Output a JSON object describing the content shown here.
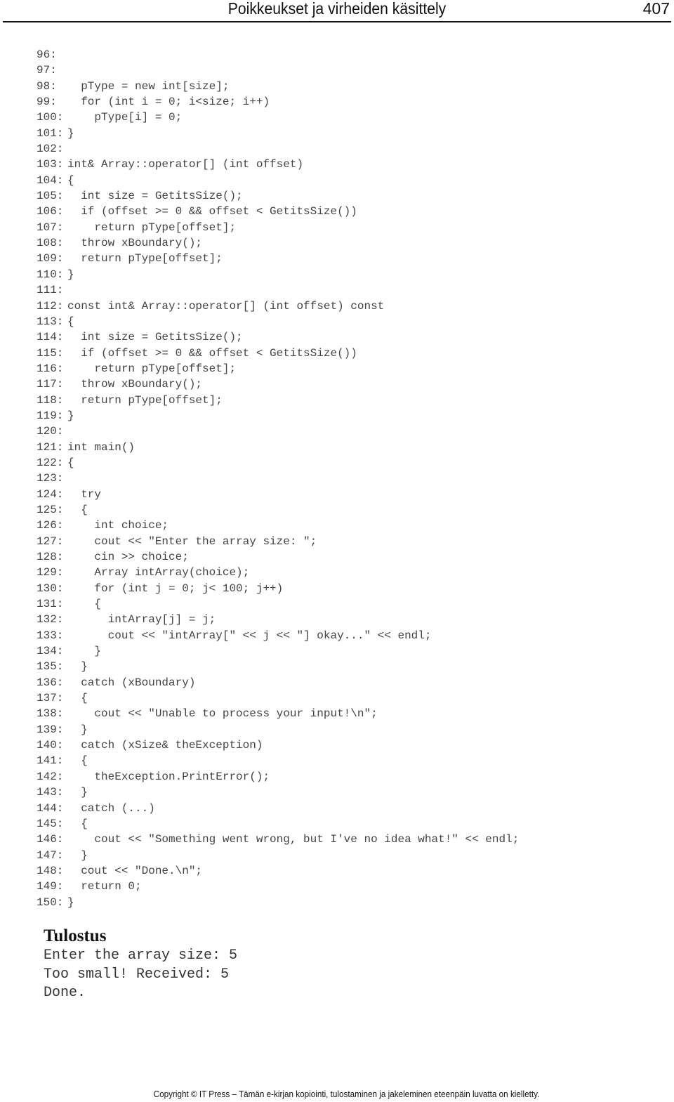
{
  "header": {
    "title": "Poikkeukset ja virheiden käsittely",
    "page_number": "407"
  },
  "code": [
    {
      "num": "96:",
      "text": ""
    },
    {
      "num": "97:",
      "text": ""
    },
    {
      "num": "98:",
      "text": "  pType = new int[size];"
    },
    {
      "num": "99:",
      "text": "  for (int i = 0; i<size; i++)"
    },
    {
      "num": "100:",
      "text": "    pType[i] = 0;"
    },
    {
      "num": "101:",
      "text": "}"
    },
    {
      "num": "102:",
      "text": ""
    },
    {
      "num": "103:",
      "text": "int& Array::operator[] (int offset)"
    },
    {
      "num": "104:",
      "text": "{"
    },
    {
      "num": "105:",
      "text": "  int size = GetitsSize();"
    },
    {
      "num": "106:",
      "text": "  if (offset >= 0 && offset < GetitsSize())"
    },
    {
      "num": "107:",
      "text": "    return pType[offset];"
    },
    {
      "num": "108:",
      "text": "  throw xBoundary();"
    },
    {
      "num": "109:",
      "text": "  return pType[offset];"
    },
    {
      "num": "110:",
      "text": "}"
    },
    {
      "num": "111:",
      "text": ""
    },
    {
      "num": "112:",
      "text": "const int& Array::operator[] (int offset) const"
    },
    {
      "num": "113:",
      "text": "{"
    },
    {
      "num": "114:",
      "text": "  int size = GetitsSize();"
    },
    {
      "num": "115:",
      "text": "  if (offset >= 0 && offset < GetitsSize())"
    },
    {
      "num": "116:",
      "text": "    return pType[offset];"
    },
    {
      "num": "117:",
      "text": "  throw xBoundary();"
    },
    {
      "num": "118:",
      "text": "  return pType[offset];"
    },
    {
      "num": "119:",
      "text": "}"
    },
    {
      "num": "120:",
      "text": ""
    },
    {
      "num": "121:",
      "text": "int main()"
    },
    {
      "num": "122:",
      "text": "{"
    },
    {
      "num": "123:",
      "text": ""
    },
    {
      "num": "124:",
      "text": "  try"
    },
    {
      "num": "125:",
      "text": "  {"
    },
    {
      "num": "126:",
      "text": "    int choice;"
    },
    {
      "num": "127:",
      "text": "    cout << \"Enter the array size: \";"
    },
    {
      "num": "128:",
      "text": "    cin >> choice;"
    },
    {
      "num": "129:",
      "text": "    Array intArray(choice);"
    },
    {
      "num": "130:",
      "text": "    for (int j = 0; j< 100; j++)"
    },
    {
      "num": "131:",
      "text": "    {"
    },
    {
      "num": "132:",
      "text": "      intArray[j] = j;"
    },
    {
      "num": "133:",
      "text": "      cout << \"intArray[\" << j << \"] okay...\" << endl;"
    },
    {
      "num": "134:",
      "text": "    }"
    },
    {
      "num": "135:",
      "text": "  }"
    },
    {
      "num": "136:",
      "text": "  catch (xBoundary)"
    },
    {
      "num": "137:",
      "text": "  {"
    },
    {
      "num": "138:",
      "text": "    cout << \"Unable to process your input!\\n\";"
    },
    {
      "num": "139:",
      "text": "  }"
    },
    {
      "num": "140:",
      "text": "  catch (xSize& theException)"
    },
    {
      "num": "141:",
      "text": "  {"
    },
    {
      "num": "142:",
      "text": "    theException.PrintError();"
    },
    {
      "num": "143:",
      "text": "  }"
    },
    {
      "num": "144:",
      "text": "  catch (...)"
    },
    {
      "num": "145:",
      "text": "  {"
    },
    {
      "num": "146:",
      "text": "    cout << \"Something went wrong, but I've no idea what!\" << endl;"
    },
    {
      "num": "147:",
      "text": "  }"
    },
    {
      "num": "148:",
      "text": "  cout << \"Done.\\n\";"
    },
    {
      "num": "149:",
      "text": "  return 0;"
    },
    {
      "num": "150:",
      "text": "}"
    }
  ],
  "output": {
    "heading": "Tulostus",
    "lines": [
      "Enter the array size: 5",
      "Too small! Received: 5",
      "Done."
    ]
  },
  "footer": {
    "copyright": "Copyright © IT Press – Tämän e-kirjan kopiointi, tulostaminen ja jakeleminen eteenpäin luvatta on kielletty."
  }
}
